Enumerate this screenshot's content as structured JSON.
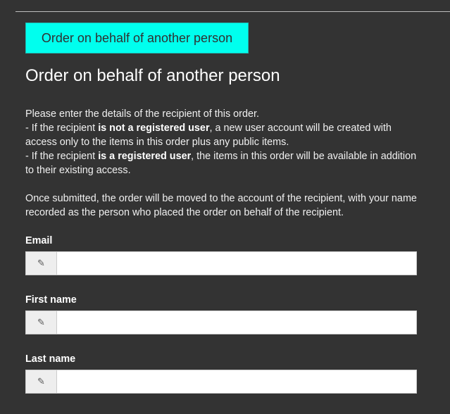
{
  "toggle_button": {
    "label": "Order on behalf of another person"
  },
  "title": "Order on behalf of another person",
  "intro": {
    "line1": "Please enter the details of the recipient of this order.",
    "para2": {
      "prefix": "- If the recipient ",
      "bold": "is not a registered user",
      "suffix": ", a new user account will be created with access only to the items in this order plus any public items."
    },
    "para3": {
      "prefix": "- If the recipient ",
      "bold": "is a registered user",
      "suffix": ", the items in this order will be available in addition to their existing access."
    },
    "para4": "Once submitted, the order will be moved to the account of the recipient, with your name recorded as the person who placed the order on behalf of the recipient."
  },
  "form": {
    "email": {
      "label": "Email",
      "value": "",
      "icon": "pencil-icon"
    },
    "first_name": {
      "label": "First name",
      "value": "",
      "icon": "pencil-icon"
    },
    "last_name": {
      "label": "Last name",
      "value": "",
      "icon": "pencil-icon"
    }
  }
}
